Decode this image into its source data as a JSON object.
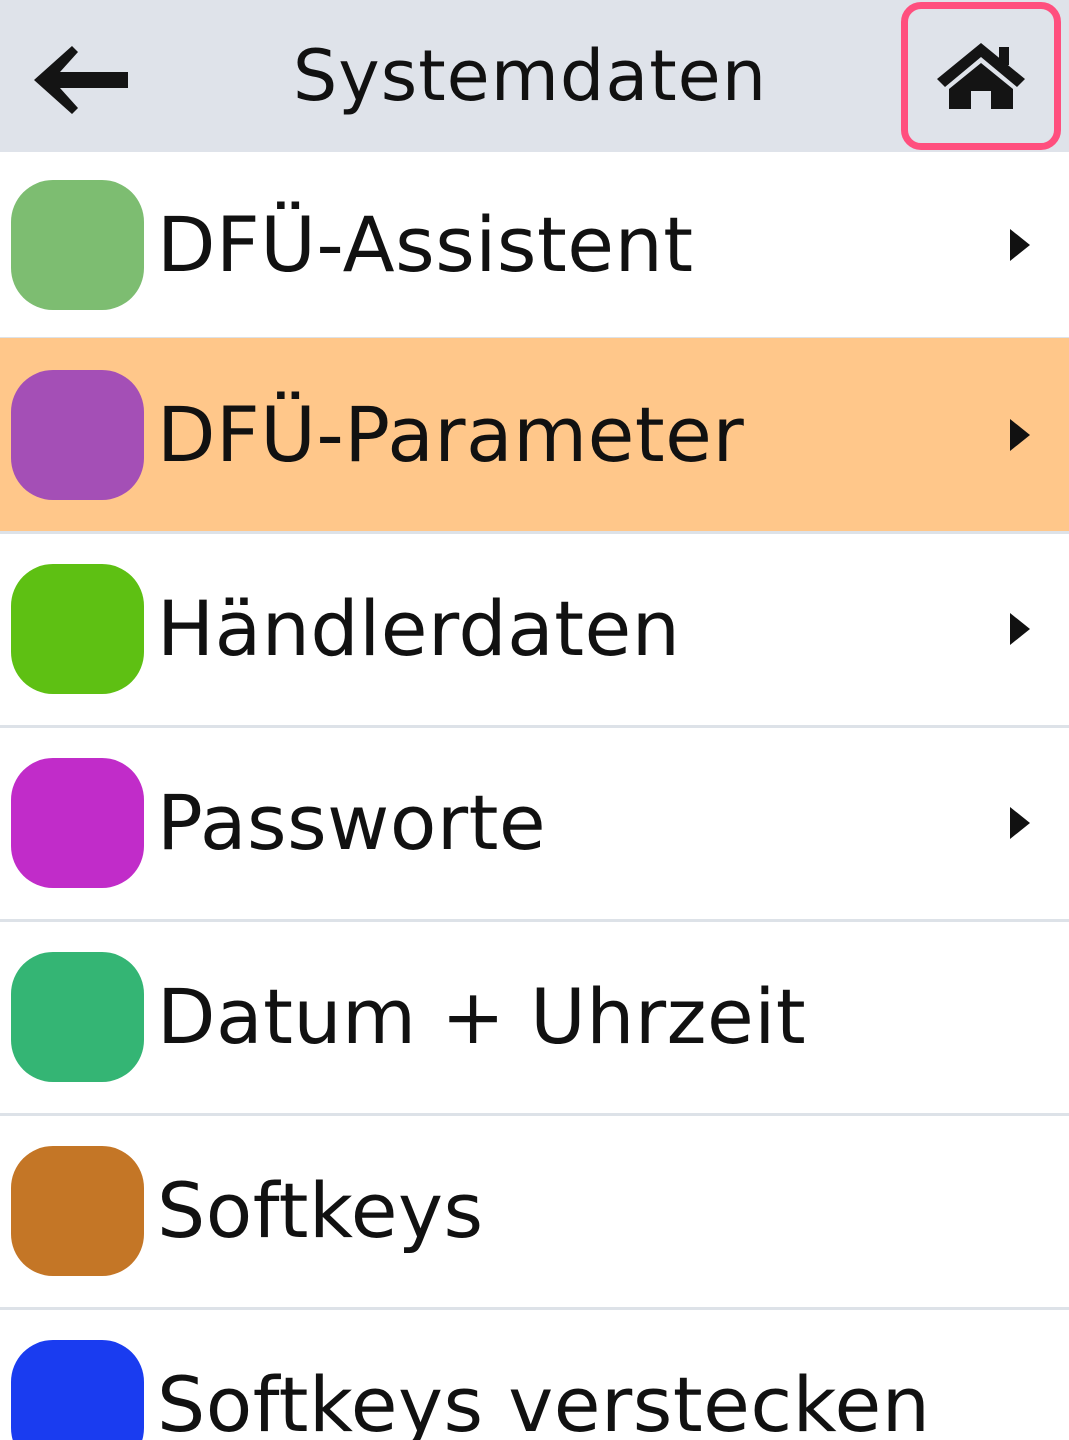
{
  "header": {
    "title": "Systemdaten",
    "back_icon": "arrow-left-icon",
    "home_icon": "home-icon",
    "home_highlight_color": "#ff4f7e",
    "background": "#dfe3ea"
  },
  "menu": {
    "selected_index": 1,
    "selected_color": "#ffc78a",
    "items": [
      {
        "label": "DFÜ-Assistent",
        "color": "#7dbd71",
        "has_submenu": true
      },
      {
        "label": "DFÜ-Parameter",
        "color": "#a44fb6",
        "has_submenu": true
      },
      {
        "label": "Händlerdaten",
        "color": "#5ec013",
        "has_submenu": true
      },
      {
        "label": "Passworte",
        "color": "#c12cc9",
        "has_submenu": true
      },
      {
        "label": "Datum + Uhrzeit",
        "color": "#34b574",
        "has_submenu": false
      },
      {
        "label": "Softkeys",
        "color": "#c47626",
        "has_submenu": false
      },
      {
        "label": "Softkeys verstecken",
        "color": "#1a3cf0",
        "has_submenu": false
      }
    ]
  }
}
